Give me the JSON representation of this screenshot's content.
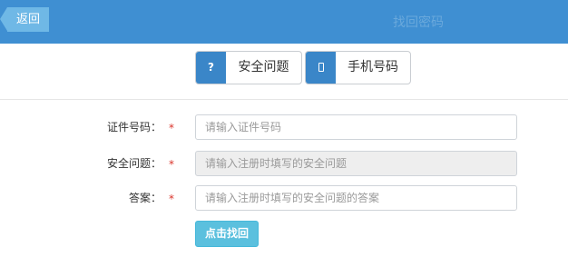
{
  "header": {
    "back_label": "返回",
    "title": "找回密码",
    "color": "#3f8fd2"
  },
  "tabs": [
    {
      "icon": "question-mark-icon",
      "icon_glyph": "?",
      "label": "安全问题",
      "active": true
    },
    {
      "icon": "mobile-phone-icon",
      "label": "手机号码",
      "active": false
    }
  ],
  "form": {
    "fields": [
      {
        "label": "证件号码：",
        "required": "*",
        "placeholder": "请输入证件号码",
        "disabled": false
      },
      {
        "label": "安全问题：",
        "required": "*",
        "placeholder": "请输入注册时填写的安全问题",
        "disabled": true
      },
      {
        "label": "答案：",
        "required": "*",
        "placeholder": "请输入注册时填写的安全问题的答案",
        "disabled": false
      }
    ],
    "submit_label": "点击找回",
    "submit_color": "#5bc0de"
  }
}
